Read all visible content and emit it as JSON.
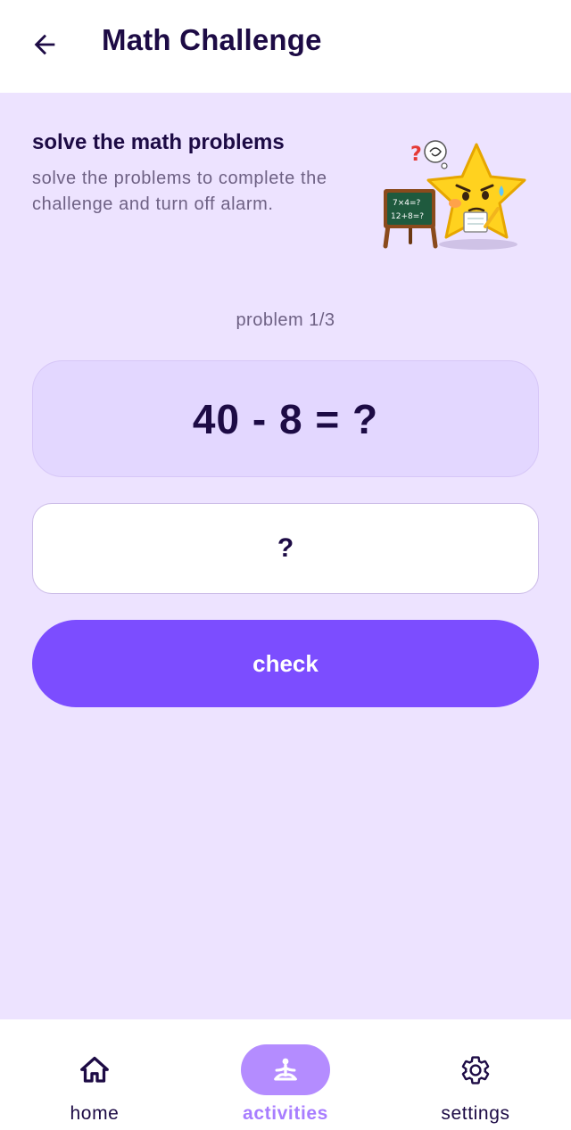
{
  "header": {
    "title": "Math Challenge",
    "back_icon": "arrow-left-icon"
  },
  "intro": {
    "title": "solve the math problems",
    "description": "solve the problems to complete the challenge and turn off alarm.",
    "mascot": {
      "icon": "star-mascot-chalkboard",
      "board_lines": [
        "7×4=?",
        "12+8=?"
      ]
    }
  },
  "problem": {
    "counter": "problem 1/3",
    "expression": "40 - 8 = ?"
  },
  "answer": {
    "value": "",
    "placeholder": "?"
  },
  "actions": {
    "check_label": "check"
  },
  "bottom_nav": {
    "items": [
      {
        "label": "home",
        "icon": "home-icon",
        "active": false
      },
      {
        "label": "activities",
        "icon": "meditation-icon",
        "active": true
      },
      {
        "label": "settings",
        "icon": "gear-icon",
        "active": false
      }
    ]
  },
  "colors": {
    "background": "#ede3ff",
    "accent": "#7c4dff",
    "active_pill": "#b48cff",
    "text_primary": "#1d0b45",
    "text_secondary": "#6e6184"
  }
}
